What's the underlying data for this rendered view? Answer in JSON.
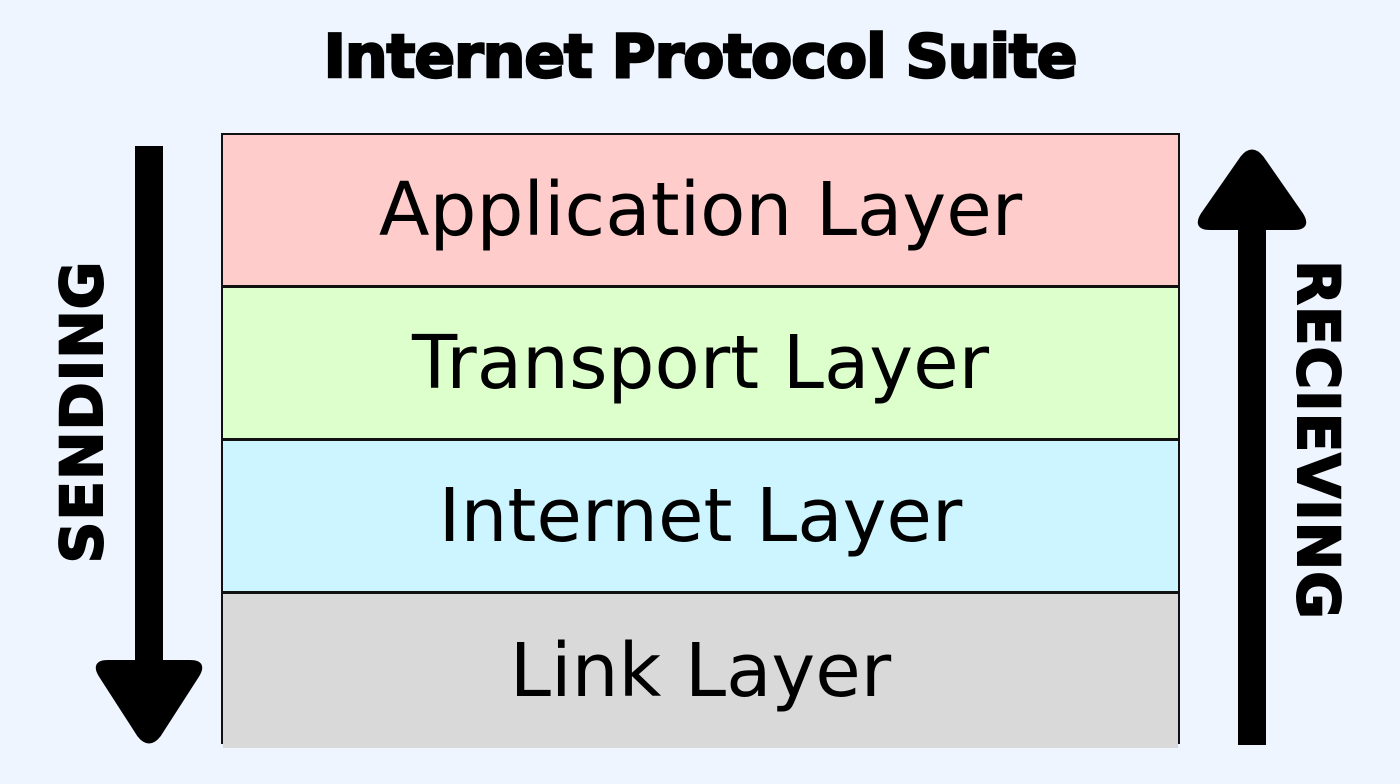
{
  "title": "Internet Protocol Suite",
  "layers": [
    {
      "label": "Application Layer",
      "color": "#ffcccc"
    },
    {
      "label": "Transport Layer",
      "color": "#ddffcc"
    },
    {
      "label": "Internet Layer",
      "color": "#ccf5ff"
    },
    {
      "label": "Link Layer",
      "color": "#d9d9d9"
    }
  ],
  "left_label": "SENDING",
  "right_label": "RECIEVING",
  "left_arrow_direction": "down",
  "right_arrow_direction": "up"
}
